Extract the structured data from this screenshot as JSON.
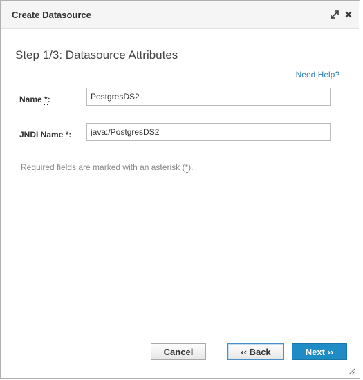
{
  "dialog": {
    "title": "Create Datasource",
    "step_heading": "Step 1/3: Datasource Attributes",
    "help_link": "Need Help?"
  },
  "form": {
    "name_label": "Name",
    "name_value": "PostgresDS2",
    "jndi_label": "JNDI Name",
    "jndi_value": "java:/PostgresDS2",
    "required_marker": "*",
    "label_suffix": ":",
    "hint_prefix": "Required fields are marked with an asterisk (",
    "hint_suffix": ")."
  },
  "buttons": {
    "cancel": "Cancel",
    "back": "‹‹ Back",
    "next": "Next ››"
  },
  "icons": {
    "expand": "expand-icon",
    "close": "close-icon",
    "resize": "resize-handle-icon"
  },
  "colors": {
    "primary": "#1f8cc6",
    "link": "#2a80b9"
  }
}
